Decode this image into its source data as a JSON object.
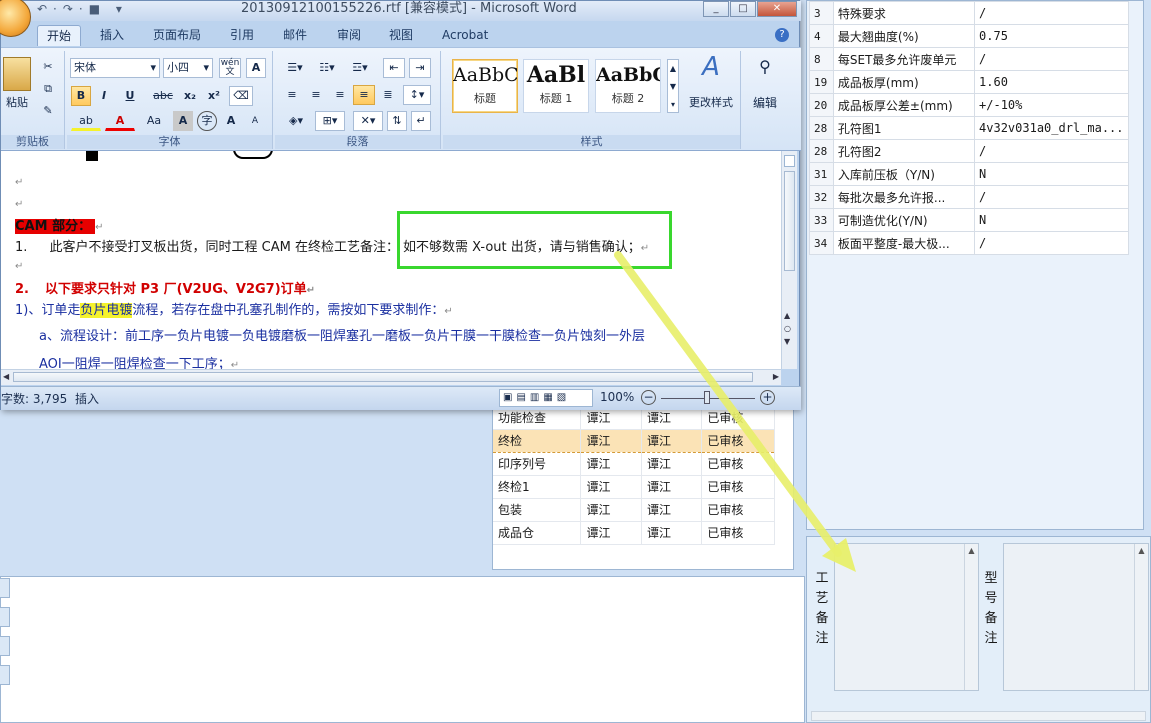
{
  "word": {
    "title": "20130912100155226.rtf [兼容模式] - Microsoft Word",
    "qat_icons": [
      "undo-icon",
      "redo-icon",
      "save-icon"
    ],
    "tabs": [
      "开始",
      "插入",
      "页面布局",
      "引用",
      "邮件",
      "审阅",
      "视图",
      "Acrobat"
    ],
    "ribbon": {
      "clipboard": {
        "paste": "粘贴",
        "label": "剪贴板"
      },
      "font": {
        "name": "宋体",
        "size": "小四",
        "label": "字体",
        "wen": "wén 文",
        "A_box": "A",
        "bold": "B",
        "italic": "I",
        "underline": "U",
        "strike": "abc",
        "sub": "x₂",
        "sup": "x²",
        "aa": "Aa",
        "grow": "A",
        "shrink": "A"
      },
      "paragraph": {
        "label": "段落"
      },
      "styles": {
        "label": "样式",
        "items": [
          {
            "sample": "AaBbC",
            "name": "标题"
          },
          {
            "sample": "AaBl",
            "name": "标题 1"
          },
          {
            "sample": "AaBbC",
            "name": "标题 2"
          }
        ],
        "change": "更改样式"
      },
      "editing": {
        "label": "编辑"
      }
    },
    "doc": {
      "heading_cam": "CAM 部分：",
      "line1_num": "1.",
      "line1_a": "此客户不接受打叉板出货，同时工程 CAM 在终检工艺备注：",
      "line1_b": "如不够数需 X-out 出货，请与销售确认；",
      "line2_num": "2.",
      "line2": "以下要求只针对 P3 厂(V2UG、V2G7)订单",
      "line3_a": "1)、订单走",
      "line3_hl": "负片电镀",
      "line3_b": "流程，若存在盘中孔塞孔制作的，需按如下要求制作：",
      "line4": "a、流程设计：前工序一负片电镀一负电镀磨板一阻焊塞孔一磨板一负片干膜一干膜检查一负片蚀刻一外层",
      "line5": "AOI一阻焊一阻焊检查一下工序；"
    },
    "status": {
      "words": "字数: 3,795",
      "mode": "插入",
      "zoom": "100%"
    }
  },
  "properties": [
    {
      "num": "3",
      "name": "特殊要求",
      "value": "/"
    },
    {
      "num": "4",
      "name": "最大翘曲度(%)",
      "value": "0.75"
    },
    {
      "num": "8",
      "name": "每SET最多允许废单元",
      "value": "/"
    },
    {
      "num": "19",
      "name": "成品板厚(mm)",
      "value": "1.60"
    },
    {
      "num": "20",
      "name": "成品板厚公差±(mm)",
      "value": "+/-10%"
    },
    {
      "num": "28",
      "name": "孔符图1",
      "value": "4v32v031a0_drl_ma..."
    },
    {
      "num": "28",
      "name": "孔符图2",
      "value": "/"
    },
    {
      "num": "31",
      "name": "入库前压板（Y/N)",
      "value": "N"
    },
    {
      "num": "32",
      "name": "每批次最多允许报...",
      "value": "/"
    },
    {
      "num": "33",
      "name": "可制造优化(Y/N)",
      "value": "N"
    },
    {
      "num": "34",
      "name": "板面平整度-最大极...",
      "value": "/"
    }
  ],
  "steps": [
    {
      "name": "功能检查",
      "a": "谭江",
      "b": "谭江",
      "status": "已审核"
    },
    {
      "name": "终检",
      "a": "谭江",
      "b": "谭江",
      "status": "已审核"
    },
    {
      "name": "印序列号",
      "a": "谭江",
      "b": "谭江",
      "status": "已审核"
    },
    {
      "name": "终检1",
      "a": "谭江",
      "b": "谭江",
      "status": "已审核"
    },
    {
      "name": "包装",
      "a": "谭江",
      "b": "谭江",
      "status": "已审核"
    },
    {
      "name": "成品仓",
      "a": "谭江",
      "b": "谭江",
      "status": "已审核"
    }
  ],
  "notes": {
    "process_label": [
      "工",
      "艺",
      "备",
      "注"
    ],
    "model_label": [
      "型",
      "号",
      "备",
      "注"
    ]
  },
  "colors": {
    "highlight_box": "#39d72e",
    "arrow": "#e8ef6a",
    "cam_bg": "#e60000"
  }
}
